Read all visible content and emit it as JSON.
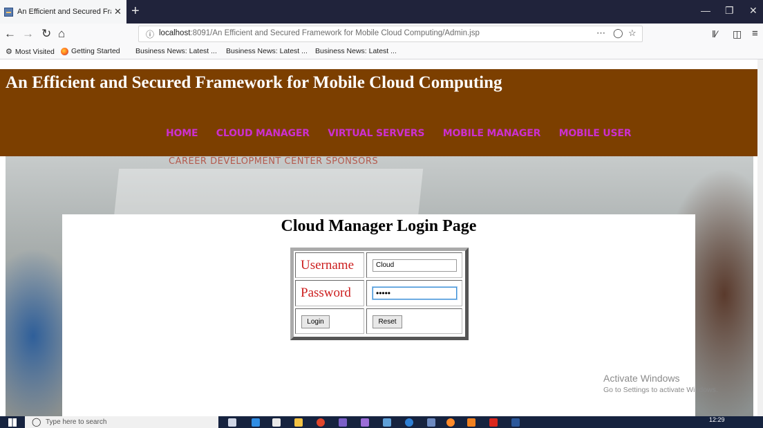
{
  "browser": {
    "tab_title": "An Efficient and Secured Frame",
    "tab_close": "✕",
    "new_tab": "+",
    "url_host": "localhost",
    "url_rest": ":8091/An Efficient and Secured Framework for Mobile Cloud Computing/Admin.jsp",
    "bookmarks": [
      "Most Visited",
      "Getting Started",
      "Business News: Latest ...",
      "Business News: Latest ...",
      "Business News: Latest ..."
    ]
  },
  "site": {
    "title": "An Efficient and Secured Framework for Mobile Cloud Computing",
    "menu": [
      "HOME",
      "CLOUD MANAGER",
      "VIRTUAL SERVERS",
      "MOBILE MANAGER",
      "MOBILE USER"
    ],
    "photo_caption": "CAREER DEVELOPMENT CENTER SPONSORS"
  },
  "login": {
    "heading": "Cloud Manager Login Page",
    "username_label": "Username",
    "password_label": "Password",
    "username_value": "Cloud",
    "password_value": "•••••",
    "login_button": "Login",
    "reset_button": "Reset"
  },
  "activation": {
    "line1": "Activate Windows",
    "line2": "Go to Settings to activate Windows."
  },
  "taskbar": {
    "search_placeholder": "Type here to search",
    "time": "12:29"
  }
}
